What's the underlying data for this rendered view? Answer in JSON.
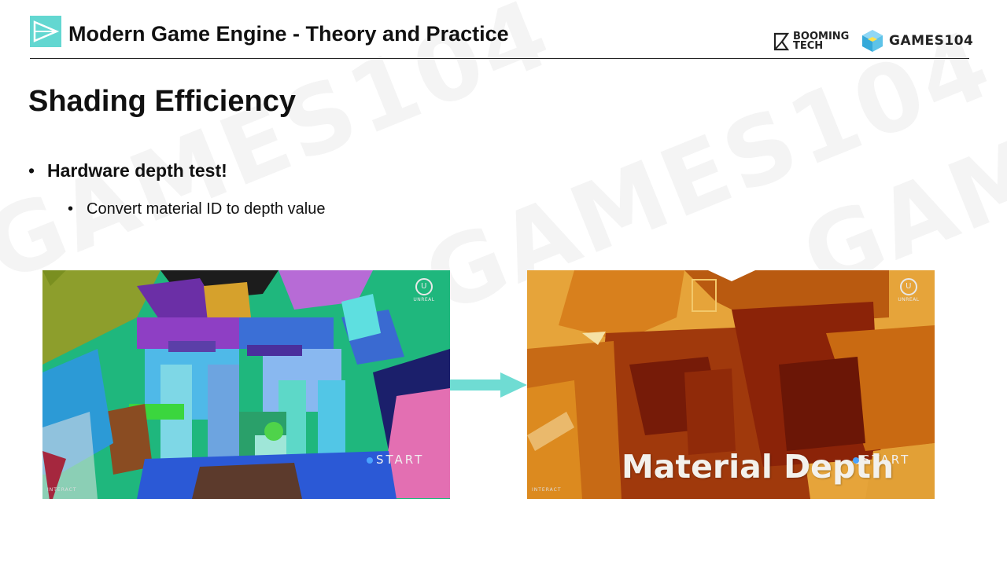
{
  "header": {
    "title": "Modern Game Engine - Theory and Practice",
    "brand_booming_line1": "BOOMING",
    "brand_booming_line2": "TECH",
    "brand_games": "GAMES104"
  },
  "slide": {
    "title": "Shading Efficiency",
    "bullet_main": "Hardware depth test!",
    "bullet_sub": "Convert material ID to depth value"
  },
  "left_image": {
    "start_label": "START",
    "unreal_label": "UNREAL",
    "interact_label": "INTERACT"
  },
  "right_image": {
    "overlay_label": "Material Depth",
    "start_label": "START",
    "unreal_label": "UNREAL",
    "interact_label": "INTERACT"
  },
  "watermark": {
    "text": "GAMES104",
    "booming": "BOOMING TECH"
  },
  "colors": {
    "accent": "#63d7d1",
    "arrow": "#6fdcd3",
    "material_id_background": "#1fb77d",
    "material_depth_background": "#e6a43a"
  },
  "icons": [
    "slide-logo-icon",
    "booming-tech-logo-icon",
    "games104-cube-icon",
    "unreal-logo-icon",
    "arrow-right-icon"
  ]
}
